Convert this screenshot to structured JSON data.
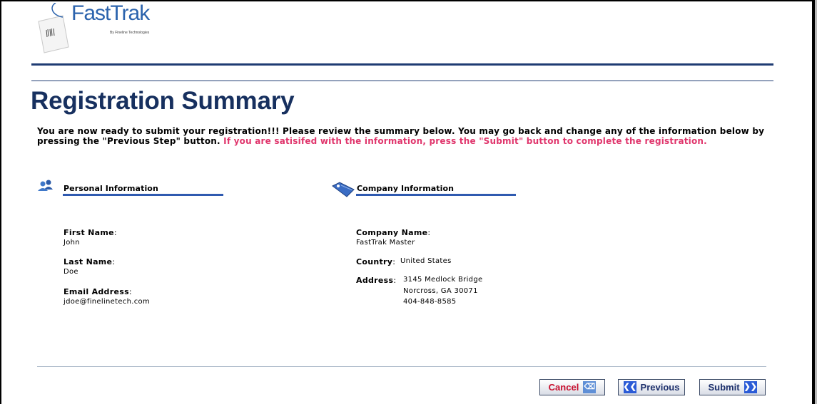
{
  "header": {
    "logo_text": "FastTrak",
    "logo_subtext": "By Fineline Technologies"
  },
  "page": {
    "title": "Registration Summary",
    "intro_text": "You are now ready to submit your registration!!! Please review the summary below. You may go back and change any of the information below by pressing the \"Previous Step\" button. ",
    "intro_highlight": "If you are satisifed with the information, press the \"Submit\" button to complete the registration."
  },
  "personal": {
    "heading": "Personal Information",
    "first_name_label": "First Name",
    "first_name": "John",
    "last_name_label": "Last Name",
    "last_name": "Doe",
    "email_label": "Email Address",
    "email": "jdoe@finelinetech.com"
  },
  "company": {
    "heading": "Company Information",
    "name_label": "Company Name",
    "name": "FastTrak Master",
    "country_label": "Country",
    "country": "United States",
    "address_label": "Address",
    "address_line1": "3145 Medlock Bridge",
    "address_line2": "Norcross, GA 30071",
    "phone": "404-848-8585"
  },
  "buttons": {
    "cancel": "Cancel",
    "previous": "Previous",
    "submit": "Submit"
  },
  "colors": {
    "brand": "#17305f",
    "highlight": "#e0356c",
    "section_rule": "#2f5ab0"
  }
}
